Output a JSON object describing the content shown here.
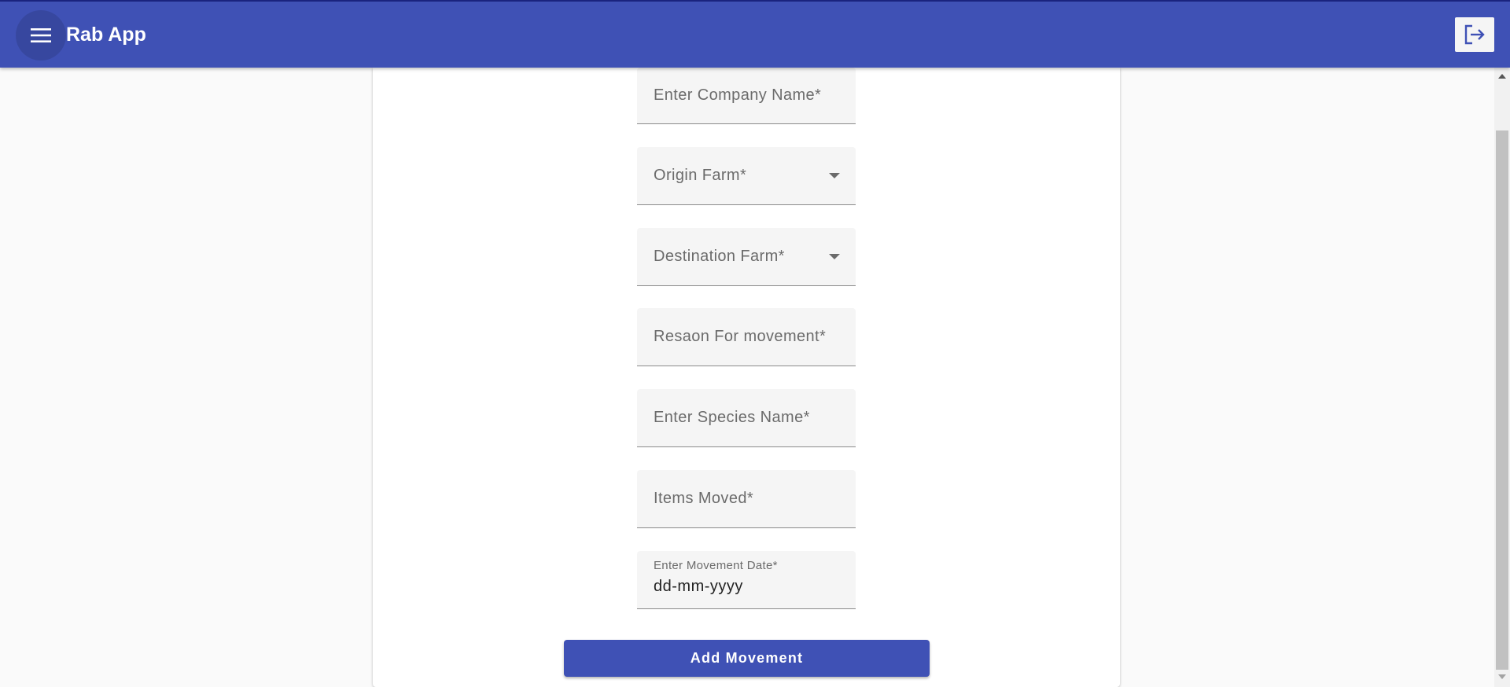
{
  "app": {
    "title": "Rab App",
    "brand_color": "#3f51b5"
  },
  "toolbar": {
    "menu_icon": "hamburger-menu-icon",
    "logout_icon": "logout-icon"
  },
  "form": {
    "company_name": {
      "label": "Enter Company Name*"
    },
    "origin_farm": {
      "label": "Origin Farm*"
    },
    "destination_farm": {
      "label": "Destination Farm*"
    },
    "reason": {
      "label": "Resaon For movement*"
    },
    "species_name": {
      "label": "Enter Species Name*"
    },
    "items_moved": {
      "label": "Items Moved*"
    },
    "movement_date": {
      "label": "Enter Movement Date*",
      "placeholder": "dd-mm-yyyy"
    },
    "submit_label": "Add Movement"
  }
}
